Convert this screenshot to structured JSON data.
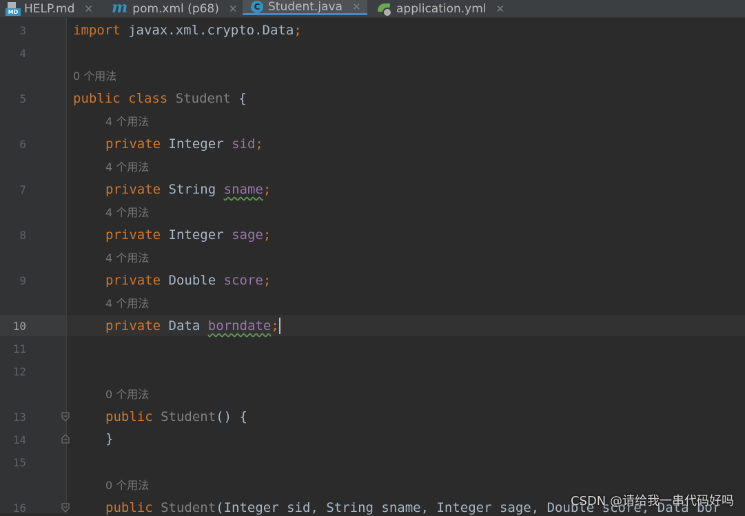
{
  "tabs": [
    {
      "label": "HELP.md",
      "icon": "markdown-file-icon",
      "active": false
    },
    {
      "label": "pom.xml (p68)",
      "icon": "maven-icon",
      "active": false
    },
    {
      "label": "Student.java",
      "icon": "java-class-icon",
      "active": true
    },
    {
      "label": "application.yml",
      "icon": "spring-config-icon",
      "active": false
    }
  ],
  "tab_icon_text": {
    "md": "MD",
    "c": "C",
    "m": "m"
  },
  "close_glyph": "✕",
  "line_numbers": [
    "3",
    "4",
    "5",
    "6",
    "7",
    "8",
    "9",
    "10",
    "11",
    "12",
    "13",
    "14",
    "15",
    "16"
  ],
  "current_line": "10",
  "usage_hints": {
    "class_hint": "0 个用法",
    "sid_hint": "4 个用法",
    "sname_hint": "4 个用法",
    "sage_hint": "4 个用法",
    "score_hint": "4 个用法",
    "borndate_hint": "4 个用法",
    "ctor1_hint": "0 个用法",
    "ctor2_hint": "0 个用法"
  },
  "code": {
    "import_kw": "import",
    "import_path": " javax.xml.crypto.Data",
    "semicolon": ";",
    "public_kw": "public",
    "class_kw": "class",
    "class_name": "Student",
    "open_brace": "{",
    "close_brace": "}",
    "private_kw": "private",
    "fields": [
      {
        "type": "Integer",
        "name": "sid"
      },
      {
        "type": "String",
        "name": "sname"
      },
      {
        "type": "Integer",
        "name": "sage"
      },
      {
        "type": "Double",
        "name": "score"
      },
      {
        "type": "Data",
        "name": "borndate"
      }
    ],
    "ctor_name": "Student",
    "ctor_params_empty": "()",
    "ctor2_params": "(Integer sid, String sname, Integer sage, Double score, Data bor"
  },
  "watermark": "CSDN @请给我一串代码好吗",
  "colors": {
    "background": "#2b2b2b",
    "gutter": "#313335",
    "keyword": "#cc7832",
    "field": "#9876aa",
    "text": "#a9b7c6",
    "hint": "#787878",
    "active_tab_underline": "#4a88c7"
  }
}
